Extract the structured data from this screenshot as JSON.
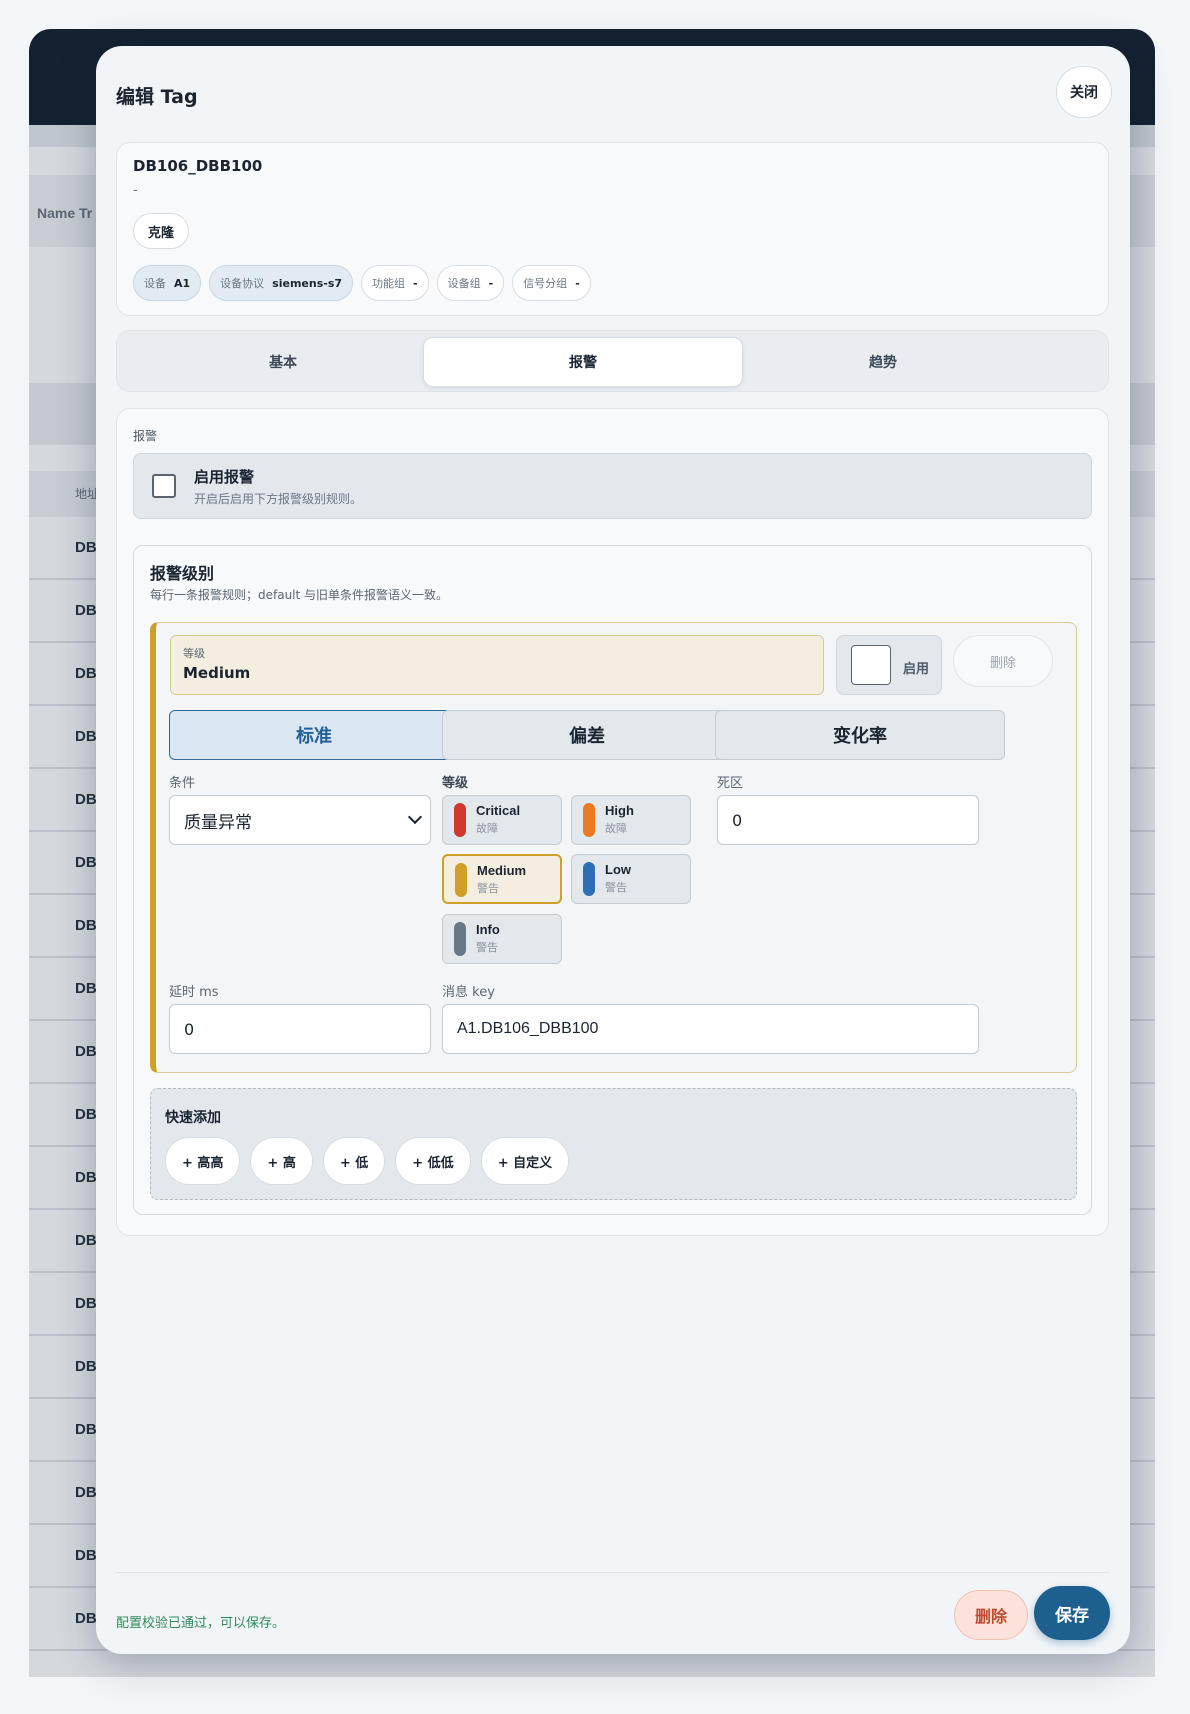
{
  "background": {
    "table_header": "Name Tr",
    "address_header": "地址",
    "row_prefix": "DB"
  },
  "modal": {
    "title": "编辑 Tag",
    "close_label": "关闭",
    "tag": {
      "name": "DB106_DBB100",
      "description": "-",
      "clone_label": "克隆"
    },
    "chips": [
      {
        "label": "设备",
        "value": "A1"
      },
      {
        "label": "设备协议",
        "value": "siemens-s7"
      },
      {
        "label": "功能组",
        "value": "-"
      },
      {
        "label": "设备组",
        "value": "-"
      },
      {
        "label": "信号分组",
        "value": "-"
      }
    ],
    "tabs": [
      "基本",
      "报警",
      "趋势"
    ],
    "active_tab": "报警",
    "alarm": {
      "section_label": "报警",
      "enable_title": "启用报警",
      "enable_sub": "开启后启用下方报警级别规则。",
      "enabled": false,
      "levels_title": "报警级别",
      "levels_sub": "每行一条报警规则；default 与旧单条件报警语义一致。",
      "rule": {
        "level_label": "等级",
        "level_value": "Medium",
        "enable_label": "启用",
        "delete_label": "删除",
        "modes": [
          "标准",
          "偏差",
          "变化率"
        ],
        "active_mode": "标准",
        "condition_label": "条件",
        "condition_value": "质量异常",
        "severity_label": "等级",
        "severities": [
          {
            "name": "Critical",
            "kind": "故障",
            "color": "#d0392c"
          },
          {
            "name": "High",
            "kind": "故障",
            "color": "#e97a25"
          },
          {
            "name": "Medium",
            "kind": "警告",
            "color": "#cf9f27"
          },
          {
            "name": "Low",
            "kind": "警告",
            "color": "#2d6fb5"
          },
          {
            "name": "Info",
            "kind": "警告",
            "color": "#6a7787"
          }
        ],
        "selected_severity": "Medium",
        "deadband_label": "死区",
        "deadband_value": "0",
        "delay_label": "延时 ms",
        "delay_value": "0",
        "message_key_label": "消息 key",
        "message_key_value": "A1.DB106_DBB100"
      },
      "quick_add": {
        "title": "快速添加",
        "buttons": [
          "+ 高高",
          "+ 高",
          "+ 低",
          "+ 低低",
          "+ 自定义"
        ]
      }
    },
    "footer": {
      "status": "配置校验已通过，可以保存。",
      "delete_label": "删除",
      "save_label": "保存"
    }
  }
}
